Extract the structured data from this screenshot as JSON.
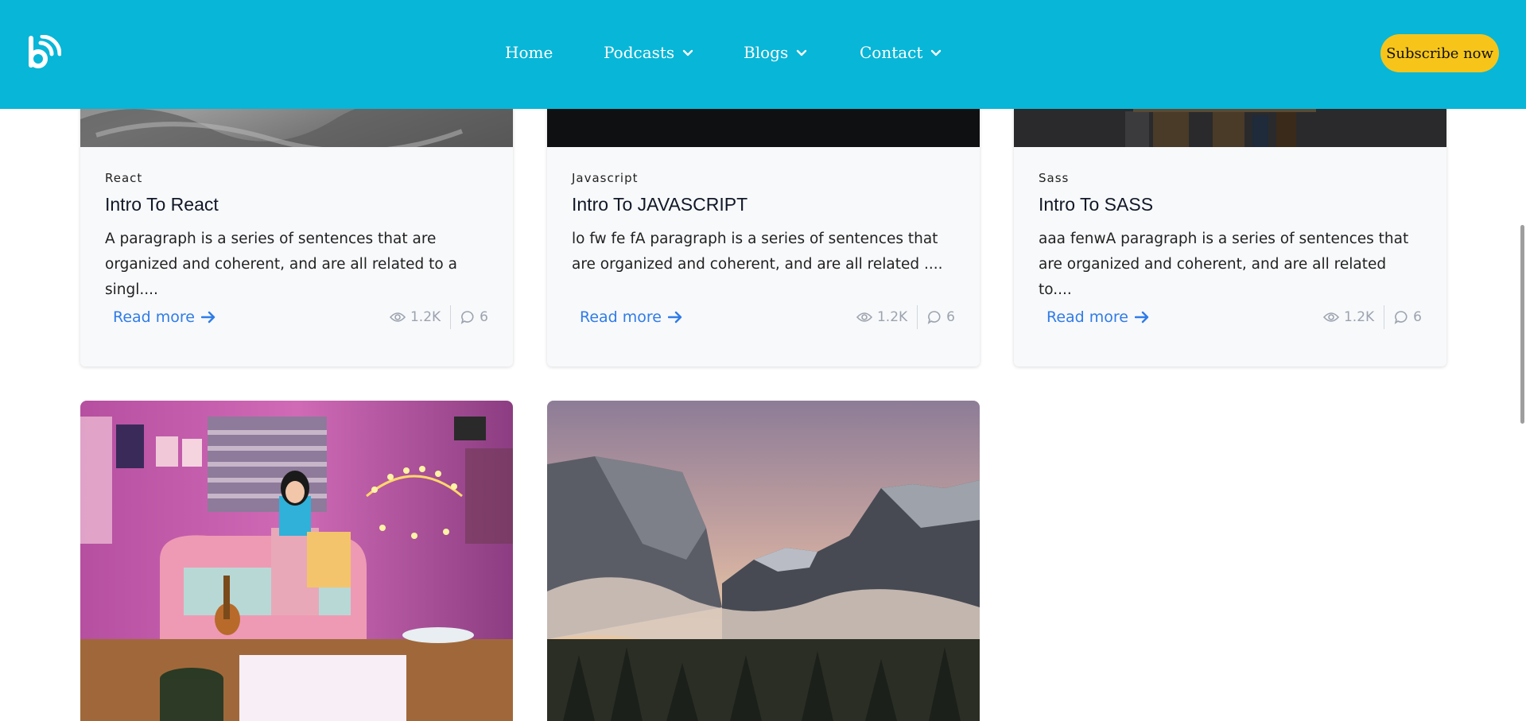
{
  "header": {
    "nav": [
      {
        "label": "Home",
        "dropdown": false
      },
      {
        "label": "Podcasts",
        "dropdown": true
      },
      {
        "label": "Blogs",
        "dropdown": true
      },
      {
        "label": "Contact",
        "dropdown": true
      }
    ],
    "subscribe_label": "Subscribe now",
    "bg_color": "#08b6d7",
    "accent_color": "#f7c51a"
  },
  "cards": [
    {
      "category": "React",
      "title": "Intro To React",
      "description": "A paragraph is a series of sentences that are organized and coherent, and are all related to a singl....",
      "read_more": "Read more",
      "views": "1.2K",
      "comments": "6"
    },
    {
      "category": "Javascript",
      "title": "Intro To JAVASCRIPT",
      "description": "lo fw fe fA paragraph is a series of sentences that are organized and coherent, and are all related ....",
      "read_more": "Read more",
      "views": "1.2K",
      "comments": "6"
    },
    {
      "category": "Sass",
      "title": "Intro To SASS",
      "description": "aaa fenwA paragraph is a series of sentences that are organized and coherent, and are all related to....",
      "read_more": "Read more",
      "views": "1.2K",
      "comments": "6"
    }
  ],
  "image_cards": [
    {
      "icon": "influencer-room-image"
    },
    {
      "icon": "mountain-valley-image"
    }
  ]
}
